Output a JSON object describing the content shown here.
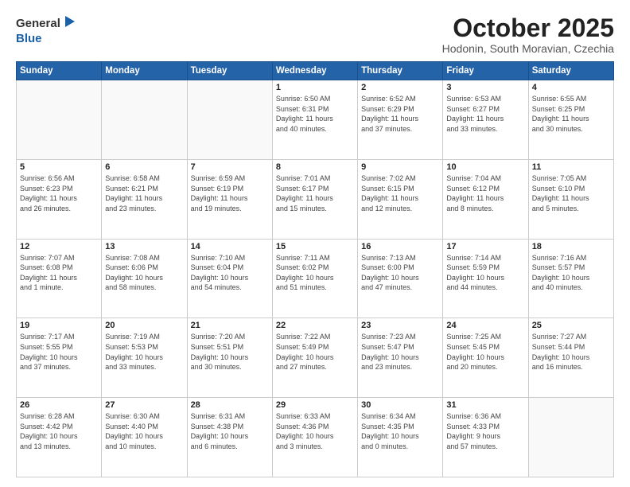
{
  "logo": {
    "general": "General",
    "blue": "Blue"
  },
  "title": "October 2025",
  "subtitle": "Hodonin, South Moravian, Czechia",
  "headers": [
    "Sunday",
    "Monday",
    "Tuesday",
    "Wednesday",
    "Thursday",
    "Friday",
    "Saturday"
  ],
  "weeks": [
    [
      {
        "day": "",
        "info": ""
      },
      {
        "day": "",
        "info": ""
      },
      {
        "day": "",
        "info": ""
      },
      {
        "day": "1",
        "info": "Sunrise: 6:50 AM\nSunset: 6:31 PM\nDaylight: 11 hours\nand 40 minutes."
      },
      {
        "day": "2",
        "info": "Sunrise: 6:52 AM\nSunset: 6:29 PM\nDaylight: 11 hours\nand 37 minutes."
      },
      {
        "day": "3",
        "info": "Sunrise: 6:53 AM\nSunset: 6:27 PM\nDaylight: 11 hours\nand 33 minutes."
      },
      {
        "day": "4",
        "info": "Sunrise: 6:55 AM\nSunset: 6:25 PM\nDaylight: 11 hours\nand 30 minutes."
      }
    ],
    [
      {
        "day": "5",
        "info": "Sunrise: 6:56 AM\nSunset: 6:23 PM\nDaylight: 11 hours\nand 26 minutes."
      },
      {
        "day": "6",
        "info": "Sunrise: 6:58 AM\nSunset: 6:21 PM\nDaylight: 11 hours\nand 23 minutes."
      },
      {
        "day": "7",
        "info": "Sunrise: 6:59 AM\nSunset: 6:19 PM\nDaylight: 11 hours\nand 19 minutes."
      },
      {
        "day": "8",
        "info": "Sunrise: 7:01 AM\nSunset: 6:17 PM\nDaylight: 11 hours\nand 15 minutes."
      },
      {
        "day": "9",
        "info": "Sunrise: 7:02 AM\nSunset: 6:15 PM\nDaylight: 11 hours\nand 12 minutes."
      },
      {
        "day": "10",
        "info": "Sunrise: 7:04 AM\nSunset: 6:12 PM\nDaylight: 11 hours\nand 8 minutes."
      },
      {
        "day": "11",
        "info": "Sunrise: 7:05 AM\nSunset: 6:10 PM\nDaylight: 11 hours\nand 5 minutes."
      }
    ],
    [
      {
        "day": "12",
        "info": "Sunrise: 7:07 AM\nSunset: 6:08 PM\nDaylight: 11 hours\nand 1 minute."
      },
      {
        "day": "13",
        "info": "Sunrise: 7:08 AM\nSunset: 6:06 PM\nDaylight: 10 hours\nand 58 minutes."
      },
      {
        "day": "14",
        "info": "Sunrise: 7:10 AM\nSunset: 6:04 PM\nDaylight: 10 hours\nand 54 minutes."
      },
      {
        "day": "15",
        "info": "Sunrise: 7:11 AM\nSunset: 6:02 PM\nDaylight: 10 hours\nand 51 minutes."
      },
      {
        "day": "16",
        "info": "Sunrise: 7:13 AM\nSunset: 6:00 PM\nDaylight: 10 hours\nand 47 minutes."
      },
      {
        "day": "17",
        "info": "Sunrise: 7:14 AM\nSunset: 5:59 PM\nDaylight: 10 hours\nand 44 minutes."
      },
      {
        "day": "18",
        "info": "Sunrise: 7:16 AM\nSunset: 5:57 PM\nDaylight: 10 hours\nand 40 minutes."
      }
    ],
    [
      {
        "day": "19",
        "info": "Sunrise: 7:17 AM\nSunset: 5:55 PM\nDaylight: 10 hours\nand 37 minutes."
      },
      {
        "day": "20",
        "info": "Sunrise: 7:19 AM\nSunset: 5:53 PM\nDaylight: 10 hours\nand 33 minutes."
      },
      {
        "day": "21",
        "info": "Sunrise: 7:20 AM\nSunset: 5:51 PM\nDaylight: 10 hours\nand 30 minutes."
      },
      {
        "day": "22",
        "info": "Sunrise: 7:22 AM\nSunset: 5:49 PM\nDaylight: 10 hours\nand 27 minutes."
      },
      {
        "day": "23",
        "info": "Sunrise: 7:23 AM\nSunset: 5:47 PM\nDaylight: 10 hours\nand 23 minutes."
      },
      {
        "day": "24",
        "info": "Sunrise: 7:25 AM\nSunset: 5:45 PM\nDaylight: 10 hours\nand 20 minutes."
      },
      {
        "day": "25",
        "info": "Sunrise: 7:27 AM\nSunset: 5:44 PM\nDaylight: 10 hours\nand 16 minutes."
      }
    ],
    [
      {
        "day": "26",
        "info": "Sunrise: 6:28 AM\nSunset: 4:42 PM\nDaylight: 10 hours\nand 13 minutes."
      },
      {
        "day": "27",
        "info": "Sunrise: 6:30 AM\nSunset: 4:40 PM\nDaylight: 10 hours\nand 10 minutes."
      },
      {
        "day": "28",
        "info": "Sunrise: 6:31 AM\nSunset: 4:38 PM\nDaylight: 10 hours\nand 6 minutes."
      },
      {
        "day": "29",
        "info": "Sunrise: 6:33 AM\nSunset: 4:36 PM\nDaylight: 10 hours\nand 3 minutes."
      },
      {
        "day": "30",
        "info": "Sunrise: 6:34 AM\nSunset: 4:35 PM\nDaylight: 10 hours\nand 0 minutes."
      },
      {
        "day": "31",
        "info": "Sunrise: 6:36 AM\nSunset: 4:33 PM\nDaylight: 9 hours\nand 57 minutes."
      },
      {
        "day": "",
        "info": ""
      }
    ]
  ]
}
